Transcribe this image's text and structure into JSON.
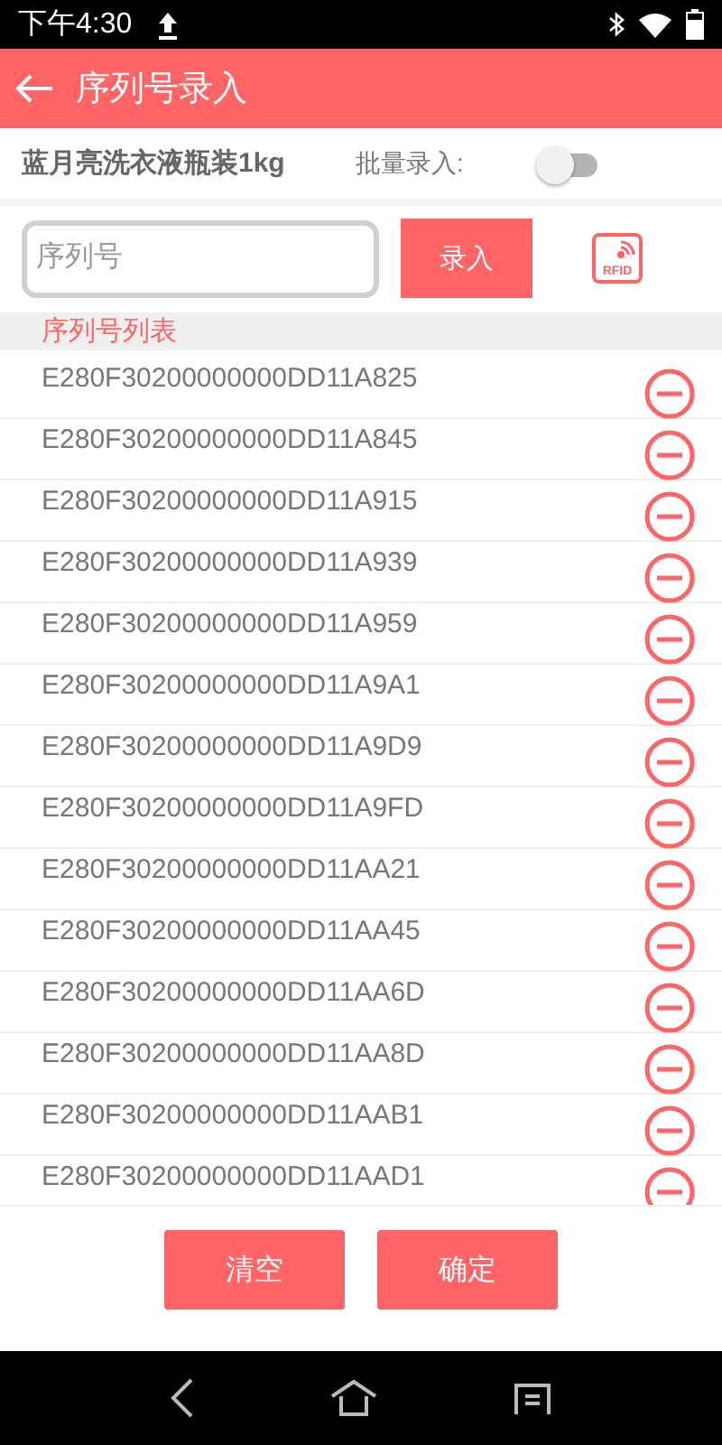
{
  "status_bar": {
    "time": "下午4:30"
  },
  "header": {
    "title": "序列号录入"
  },
  "product": {
    "name": "蓝月亮洗衣液瓶装1kg",
    "batch_label": "批量录入:",
    "batch_on": false
  },
  "entry": {
    "placeholder": "序列号",
    "button": "录入",
    "rfid_label": "RFID"
  },
  "list": {
    "title": "序列号列表",
    "items": [
      "E280F30200000000DD11A825",
      "E280F30200000000DD11A845",
      "E280F30200000000DD11A915",
      "E280F30200000000DD11A939",
      "E280F30200000000DD11A959",
      "E280F30200000000DD11A9A1",
      "E280F30200000000DD11A9D9",
      "E280F30200000000DD11A9FD",
      "E280F30200000000DD11AA21",
      "E280F30200000000DD11AA45",
      "E280F30200000000DD11AA6D",
      "E280F30200000000DD11AA8D",
      "E280F30200000000DD11AAB1",
      "E280F30200000000DD11AAD1"
    ]
  },
  "buttons": [
    "清空",
    "确定"
  ]
}
